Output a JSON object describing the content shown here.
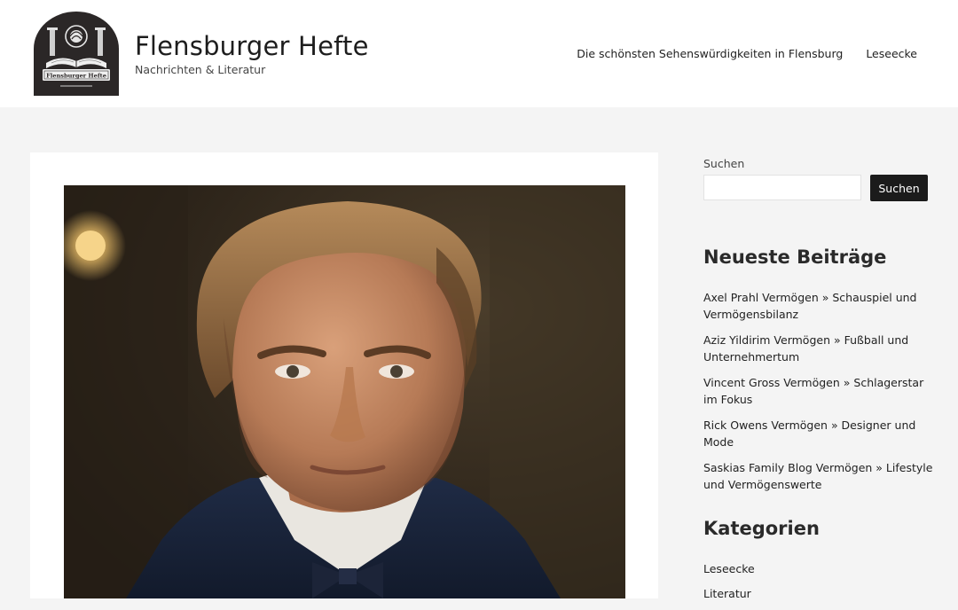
{
  "header": {
    "logo_text": "Flensburger Hefte",
    "title": "Flensburger Hefte",
    "tagline": "Nachrichten & Literatur",
    "nav": [
      {
        "label": "Die schönsten Sehenswürdigkeiten in Flensburg"
      },
      {
        "label": "Leseecke"
      }
    ]
  },
  "main": {
    "image_icon": "portrait-photo"
  },
  "sidebar": {
    "search": {
      "label": "Suchen",
      "placeholder": "",
      "value": "",
      "button_label": "Suchen"
    },
    "recent_posts": {
      "title": "Neueste Beiträge",
      "items": [
        {
          "label": "Axel Prahl Vermögen » Schauspiel und Vermögensbilanz"
        },
        {
          "label": "Aziz Yildirim Vermögen » Fußball und Unternehmertum"
        },
        {
          "label": "Vincent Gross Vermögen » Schlagerstar im Fokus"
        },
        {
          "label": "Rick Owens Vermögen » Designer und Mode"
        },
        {
          "label": "Saskias Family Blog Vermögen » Lifestyle und Vermögenswerte"
        }
      ]
    },
    "categories": {
      "title": "Kategorien",
      "items": [
        {
          "label": "Leseecke"
        },
        {
          "label": "Literatur"
        }
      ]
    }
  }
}
